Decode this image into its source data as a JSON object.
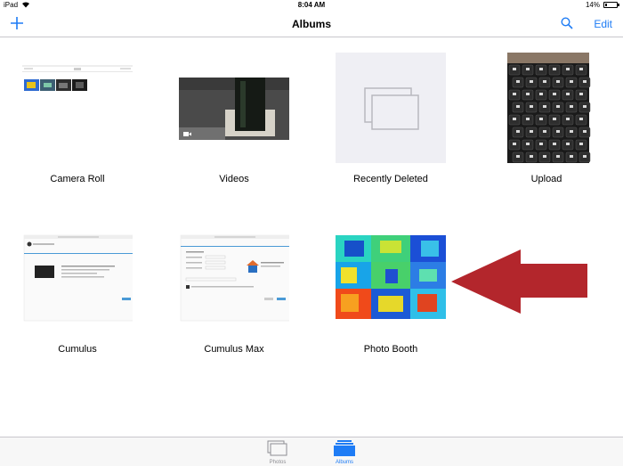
{
  "status_bar": {
    "carrier": "iPad",
    "time": "8:04 AM",
    "battery": "14%",
    "battery_level": 0.14
  },
  "nav": {
    "title": "Albums",
    "add_icon": "plus-icon",
    "search_icon": "search-icon",
    "edit_label": "Edit"
  },
  "albums": [
    {
      "name": "Camera Roll"
    },
    {
      "name": "Videos"
    },
    {
      "name": "Recently Deleted"
    },
    {
      "name": "Upload"
    },
    {
      "name": "Cumulus"
    },
    {
      "name": "Cumulus Max"
    },
    {
      "name": "Photo Booth"
    }
  ],
  "tabs": [
    {
      "label": "Photos",
      "icon": "photos-icon",
      "active": false
    },
    {
      "label": "Albums",
      "icon": "albums-icon",
      "active": true
    }
  ],
  "colors": {
    "accent": "#1e7cf5",
    "arrow": "#b3262c",
    "tab_inactive": "#8e8e93"
  }
}
